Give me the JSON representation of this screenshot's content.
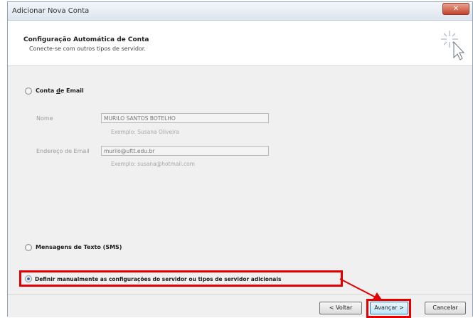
{
  "window": {
    "title": "Adicionar Nova Conta",
    "close_label": "✕"
  },
  "header": {
    "title": "Configuração Automática de Conta",
    "subtitle": "Conecte-se com outros tipos de servidor."
  },
  "options": {
    "email_account": {
      "label_pre": "Conta ",
      "label_underlined": "d",
      "label_post": "e Email",
      "selected": false
    },
    "sms": {
      "label": "Mensagens de Texto (SMS)",
      "selected": false
    },
    "manual": {
      "label": "Definir manualmente as configurações do servidor ou tipos de servidor adicionais",
      "selected": true
    }
  },
  "fields": {
    "name": {
      "label": "Nome",
      "value": "MURILO SANTOS BOTELHO",
      "hint": "Exemplo: Susana Oliveira"
    },
    "email": {
      "label": "Endereço de Email",
      "value": "murilo@uftt.edu.br",
      "hint": "Exemplo: susana@hotmail.com"
    }
  },
  "buttons": {
    "back": "< Voltar",
    "next": "Avançar >",
    "cancel": "Cancelar"
  },
  "colors": {
    "highlight": "#e20000",
    "accent": "#2b6fb8"
  }
}
